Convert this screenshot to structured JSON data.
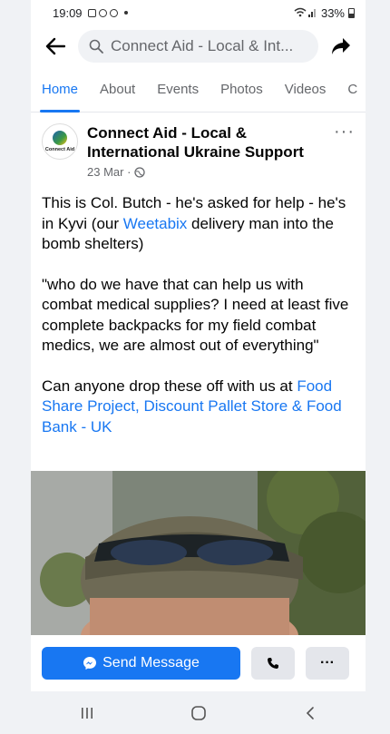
{
  "status_bar": {
    "time": "19:09",
    "battery": "33%"
  },
  "search": {
    "text": "Connect Aid - Local & Int..."
  },
  "tabs": [
    {
      "label": "Home",
      "active": true
    },
    {
      "label": "About"
    },
    {
      "label": "Events"
    },
    {
      "label": "Photos"
    },
    {
      "label": "Videos"
    },
    {
      "label": "C"
    }
  ],
  "post": {
    "avatar_label": "Connect Aid",
    "page_name": "Connect Aid - Local & International Ukraine Support",
    "date": "23 Mar ·",
    "more": "···",
    "body": {
      "p1_a": "This is Col. Butch - he's asked for help - he's in Kyvi (our ",
      "p1_link": "Weetabix",
      "p1_b": " delivery man into the bomb shelters)",
      "p2": "\"who do we have that can help us with combat medical supplies? I need at least five complete backpacks for my field combat medics, we are almost out of everything\"",
      "p3_a": "Can anyone drop these off with us at ",
      "p3_link": "Food Share Project, Discount Pallet Store & Food Bank - UK"
    }
  },
  "actions": {
    "send_message": "Send Message",
    "more": "···"
  },
  "colors": {
    "accent": "#1877f2",
    "text": "#050505",
    "muted": "#65676b"
  }
}
